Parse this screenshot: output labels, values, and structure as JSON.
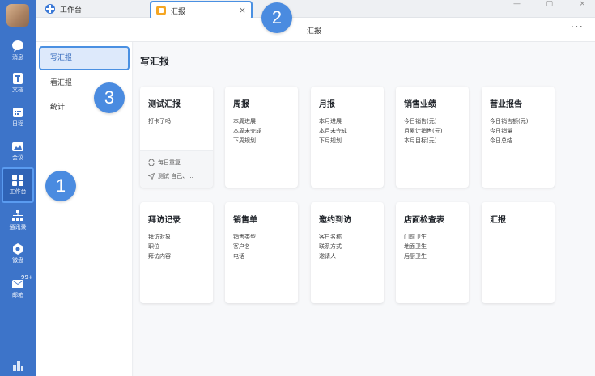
{
  "titlebar": {
    "workbench_tab": "工作台",
    "report_tab": "汇报",
    "close_icon": "×",
    "window_controls": [
      "—",
      "▢",
      "×"
    ]
  },
  "header": {
    "title": "汇报",
    "more_label": "···"
  },
  "rail": {
    "items": [
      {
        "label": "消息",
        "icon": "chat-icon"
      },
      {
        "label": "文档",
        "icon": "doc-icon"
      },
      {
        "label": "日程",
        "icon": "calendar-icon"
      },
      {
        "label": "会议",
        "icon": "meeting-icon"
      },
      {
        "label": "工作台",
        "icon": "grid-icon"
      },
      {
        "label": "通讯录",
        "icon": "org-icon"
      },
      {
        "label": "微盘",
        "icon": "drive-icon"
      },
      {
        "label": "邮箱",
        "icon": "mail-icon"
      }
    ],
    "mail_badge": "99+"
  },
  "subnav": {
    "items": [
      "写汇报",
      "看汇报",
      "统计"
    ]
  },
  "main": {
    "title": "写汇报"
  },
  "cards": [
    {
      "title": "测试汇报",
      "lines": [
        "打卡了吗"
      ],
      "footer": [
        "每日重复",
        "测试 自己、..."
      ]
    },
    {
      "title": "周报",
      "lines": [
        "本周进展",
        "本周未完成",
        "下周规划"
      ]
    },
    {
      "title": "月报",
      "lines": [
        "本月进展",
        "本月未完成",
        "下月规划"
      ]
    },
    {
      "title": "销售业绩",
      "lines": [
        "今日销售(元)",
        "月累计销售(元)",
        "本月目标(元)"
      ]
    },
    {
      "title": "营业报告",
      "lines": [
        "今日销售额(元)",
        "今日销量",
        "今日总结"
      ]
    },
    {
      "title": "拜访记录",
      "lines": [
        "拜访对象",
        "职位",
        "拜访内容"
      ]
    },
    {
      "title": "销售单",
      "lines": [
        "销售类型",
        "客户名",
        "电话"
      ]
    },
    {
      "title": "邀约到访",
      "lines": [
        "客户名称",
        "联系方式",
        "邀请人"
      ]
    },
    {
      "title": "店面检查表",
      "lines": [
        "门前卫生",
        "地面卫生",
        "后厨卫生"
      ]
    },
    {
      "title": "汇报",
      "lines": []
    }
  ],
  "callouts": [
    "1",
    "2",
    "3"
  ],
  "colors": {
    "rail": "#3d74c9",
    "accent": "#4a90e2",
    "active_bg": "#dde9fb"
  }
}
